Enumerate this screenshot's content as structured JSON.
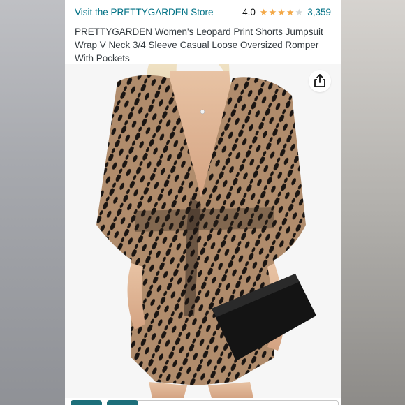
{
  "header": {
    "store_link": "Visit the PRETTYGARDEN Store",
    "rating_value": "4.0",
    "review_count": "3,359",
    "product_title": "PRETTYGARDEN Women's Leopard Print Shorts Jumpsuit Wrap V Neck 3/4 Sleeve Casual Loose Oversized Romper With Pockets"
  },
  "rating": {
    "stars": 4.0,
    "max": 5
  },
  "icons": {
    "share": "share-icon"
  },
  "colors": {
    "link": "#007185",
    "star": "#f3a847",
    "accent": "#1d6f7a"
  }
}
